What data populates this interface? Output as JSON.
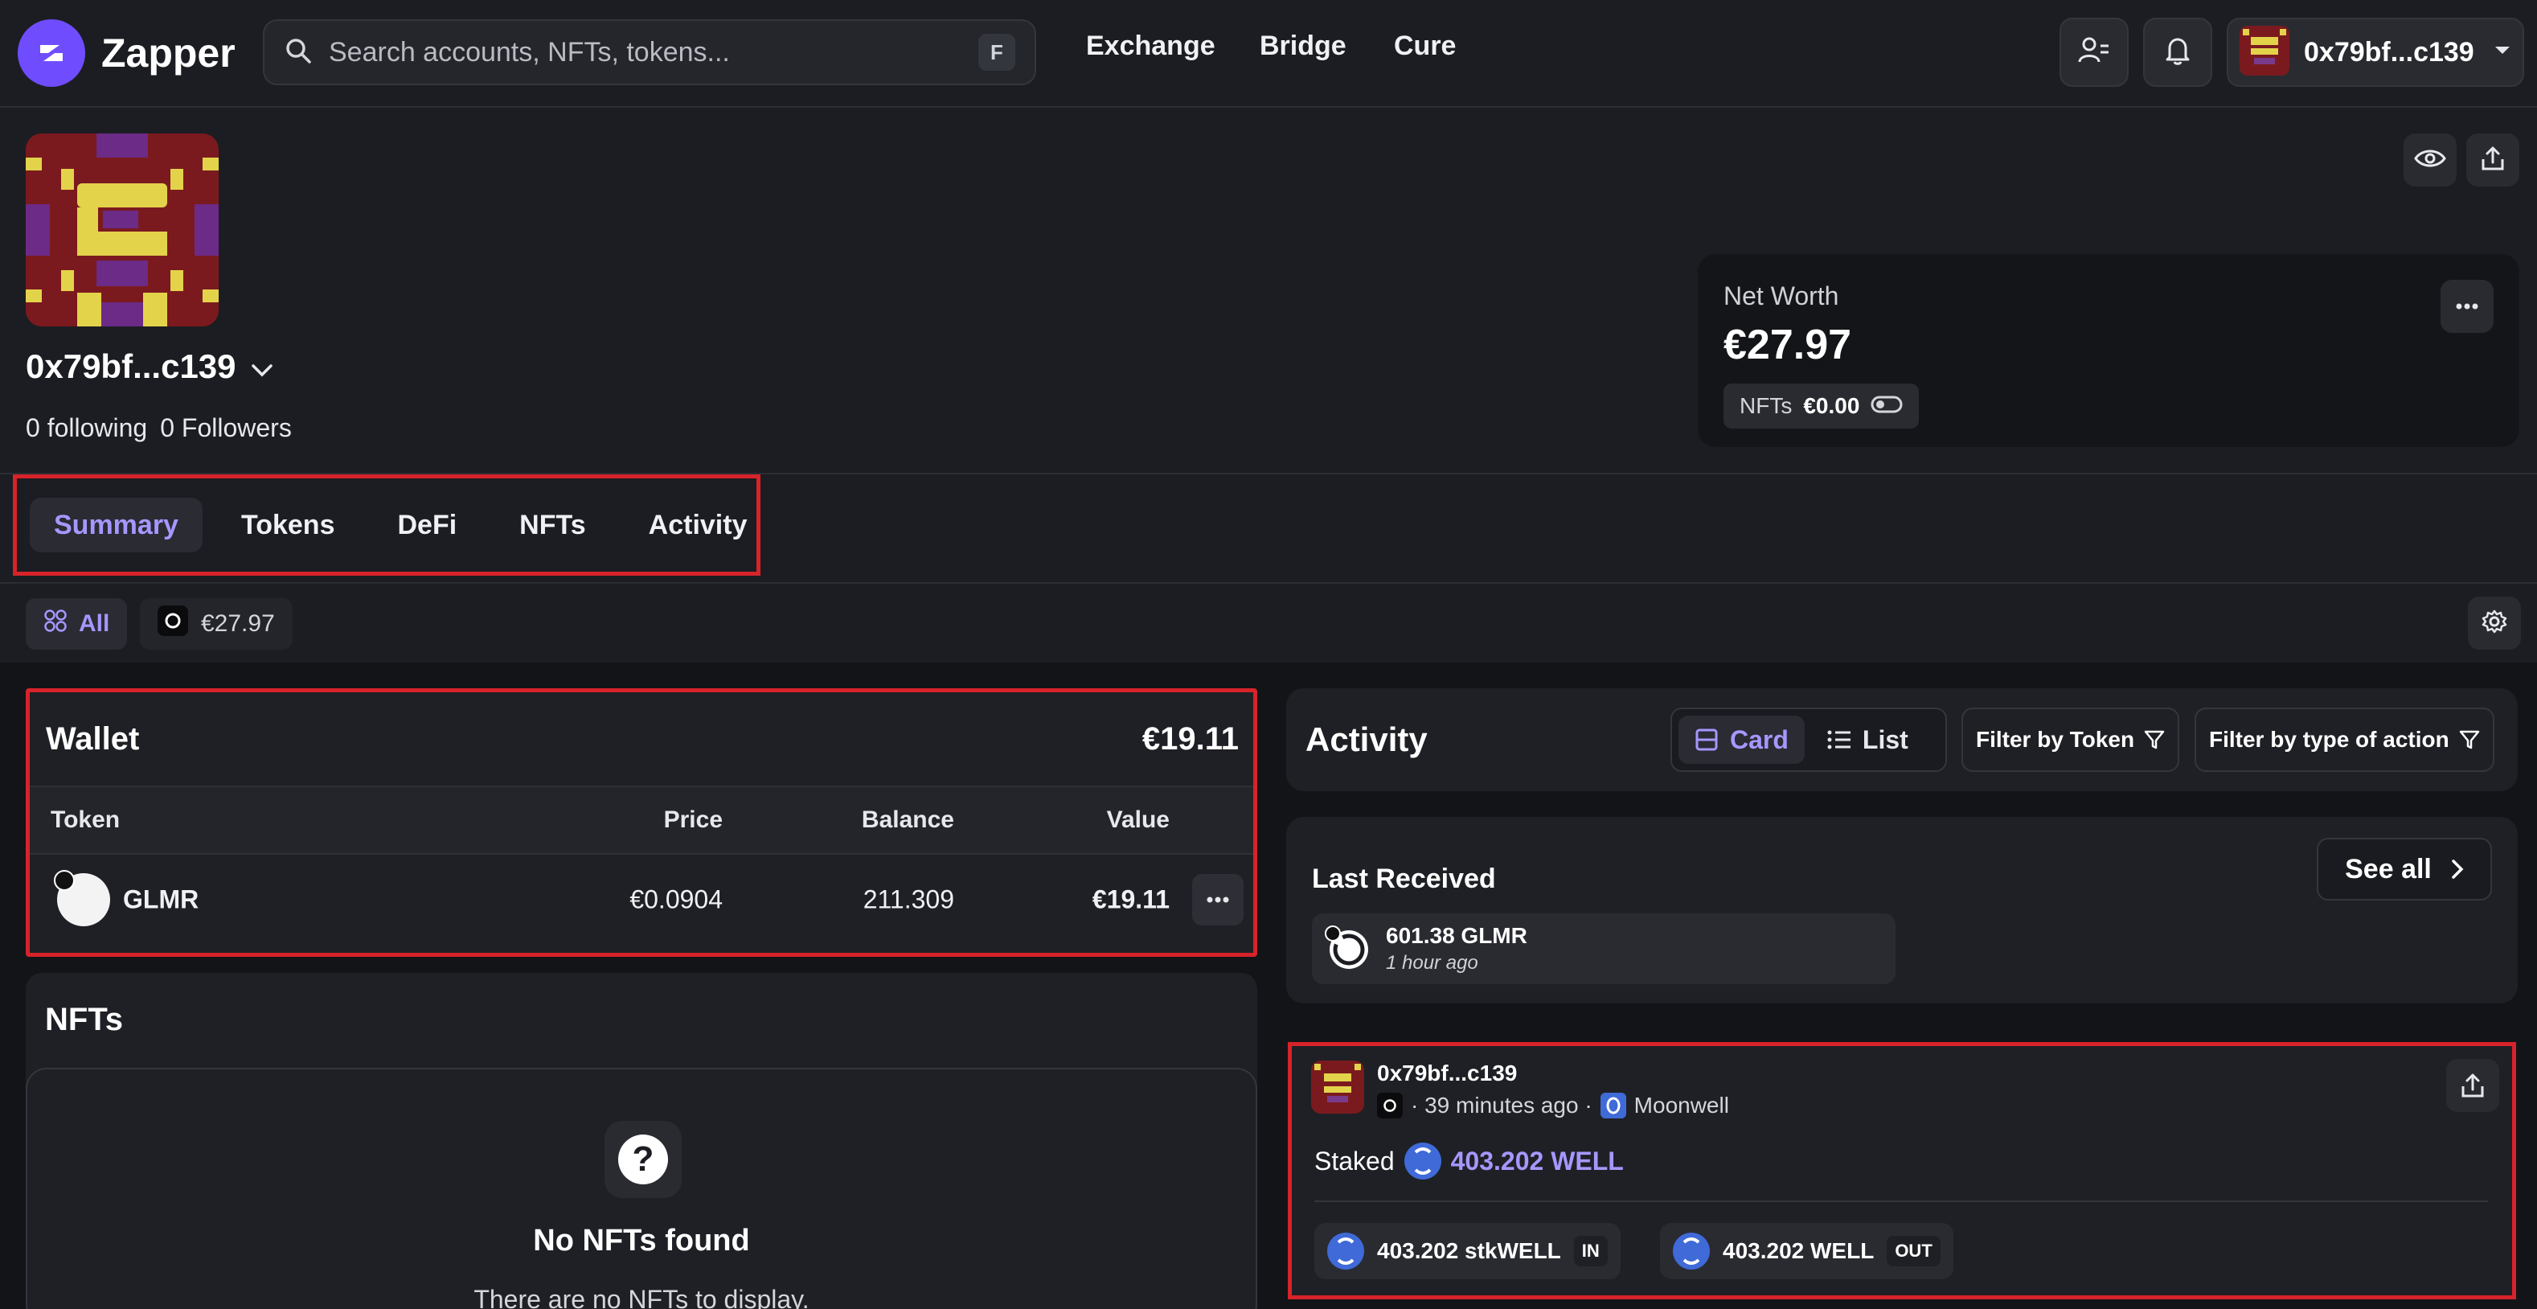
{
  "header": {
    "brand": "Zapper",
    "search": {
      "placeholder": "Search accounts, NFTs, tokens...",
      "shortcut": "F"
    },
    "nav": [
      "Exchange",
      "Bridge",
      "Cure"
    ],
    "account_label": "0x79bf...c139"
  },
  "profile": {
    "address": "0x79bf...c139",
    "following": "0 following",
    "followers": "0 Followers"
  },
  "net_worth": {
    "label": "Net Worth",
    "value": "€27.97",
    "nfts_label": "NFTs",
    "nfts_value": "€0.00"
  },
  "tabs": [
    "Summary",
    "Tokens",
    "DeFi",
    "NFTs",
    "Activity"
  ],
  "filters": {
    "all_label": "All",
    "network_value": "€27.97"
  },
  "wallet": {
    "title": "Wallet",
    "total": "€19.11",
    "columns": [
      "Token",
      "Price",
      "Balance",
      "Value"
    ],
    "rows": [
      {
        "token": "GLMR",
        "price": "€0.0904",
        "balance": "211.309",
        "value": "€19.11"
      }
    ]
  },
  "nfts": {
    "title": "NFTs",
    "empty_title": "No NFTs found",
    "empty_subtitle": "There are no NFTs to display."
  },
  "activity": {
    "title": "Activity",
    "view_card": "Card",
    "view_list": "List",
    "filter_token": "Filter by Token",
    "filter_action": "Filter by type of action",
    "last_received": {
      "title": "Last Received",
      "see_all": "See all",
      "item_amount": "601.38 GLMR",
      "item_time": "1 hour ago"
    },
    "card": {
      "who": "0x79bf...c139",
      "time": "· 39 minutes ago ·",
      "protocol": "Moonwell",
      "action": "Staked",
      "amount": "403.202 WELL",
      "in_amount": "403.202 stkWELL",
      "in_tag": "IN",
      "out_amount": "403.202 WELL",
      "out_tag": "OUT"
    }
  },
  "colors": {
    "accent": "#a697ff",
    "brand": "#6f4dff",
    "highlight_border": "#d7232a",
    "background": "#1c1d22"
  }
}
